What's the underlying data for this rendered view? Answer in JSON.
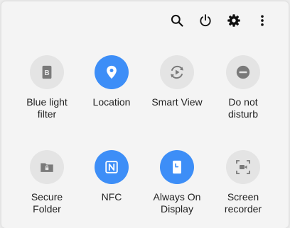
{
  "toolbar": {
    "icons": [
      "search-icon",
      "power-icon",
      "gear-icon",
      "more-vert-icon"
    ]
  },
  "colors": {
    "accent": "#3d8ef7",
    "tile_off": "#e4e4e4",
    "icon_off": "#7a7a7a",
    "text": "#222222"
  },
  "tiles": [
    {
      "label": "Blue light\nfilter",
      "icon": "blue-light-filter-icon",
      "state": "off"
    },
    {
      "label": "Location",
      "icon": "location-pin-icon",
      "state": "on"
    },
    {
      "label": "Smart View",
      "icon": "smart-view-icon",
      "state": "off"
    },
    {
      "label": "Do not\ndisturb",
      "icon": "do-not-disturb-icon",
      "state": "off"
    },
    {
      "label": "Secure\nFolder",
      "icon": "secure-folder-icon",
      "state": "off"
    },
    {
      "label": "NFC",
      "icon": "nfc-icon",
      "state": "on"
    },
    {
      "label": "Always On\nDisplay",
      "icon": "always-on-display-icon",
      "state": "on"
    },
    {
      "label": "Screen\nrecorder",
      "icon": "screen-recorder-icon",
      "state": "off"
    }
  ]
}
